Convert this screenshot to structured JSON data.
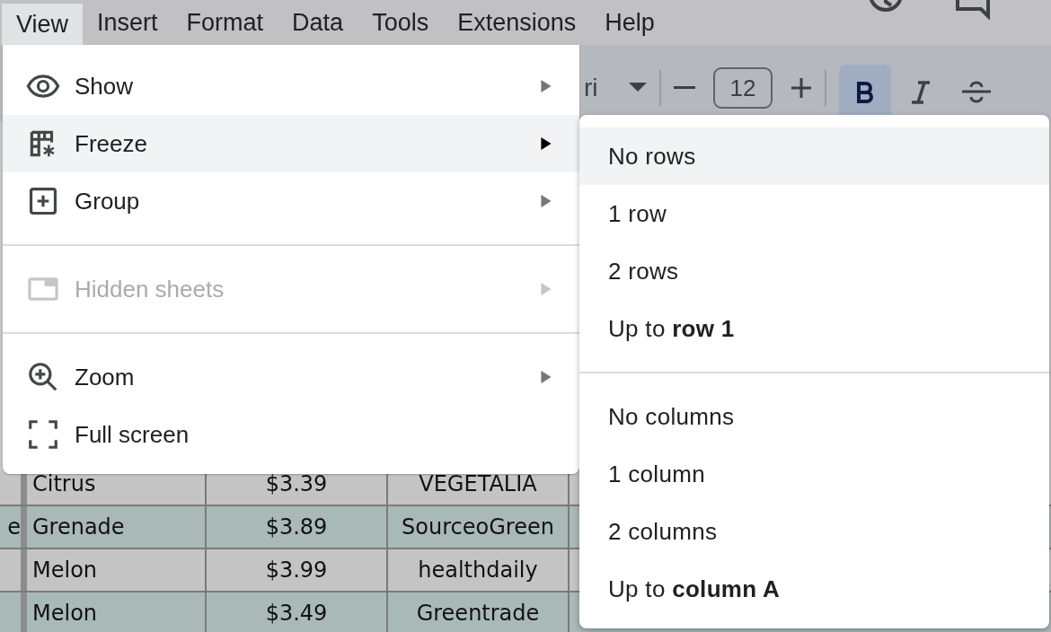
{
  "menubar": {
    "items": [
      {
        "label": "View",
        "selected": true
      },
      {
        "label": "Insert",
        "selected": false
      },
      {
        "label": "Format",
        "selected": false
      },
      {
        "label": "Data",
        "selected": false
      },
      {
        "label": "Tools",
        "selected": false
      },
      {
        "label": "Extensions",
        "selected": false
      },
      {
        "label": "Help",
        "selected": false
      }
    ]
  },
  "toolbar": {
    "font_name": "ri",
    "font_size": "12",
    "bold": {
      "selected": true
    },
    "italic": {
      "selected": false
    },
    "strikethrough": {
      "selected": false
    }
  },
  "sheet": {
    "rows": [
      {
        "cells": [
          "",
          "Citrus",
          "$3.39",
          "VEGETALIA"
        ]
      },
      {
        "cells": [
          "e",
          "Grenade",
          "$3.89",
          "SourceoGreen"
        ]
      },
      {
        "cells": [
          "",
          "Melon",
          "$3.99",
          "healthdaily"
        ]
      },
      {
        "cells": [
          "",
          "Melon",
          "$3.49",
          "Greentrade"
        ]
      }
    ]
  },
  "view_menu": {
    "items": [
      {
        "kind": "submenu",
        "label": "Show",
        "highlighted": false,
        "disabled": false
      },
      {
        "kind": "submenu",
        "label": "Freeze",
        "highlighted": true,
        "disabled": false
      },
      {
        "kind": "submenu",
        "label": "Group",
        "highlighted": false,
        "disabled": false
      },
      {
        "kind": "divider"
      },
      {
        "kind": "submenu",
        "label": "Hidden sheets",
        "highlighted": false,
        "disabled": true
      },
      {
        "kind": "divider"
      },
      {
        "kind": "submenu",
        "label": "Zoom",
        "highlighted": false,
        "disabled": false
      },
      {
        "kind": "action",
        "label": "Full screen",
        "highlighted": false,
        "disabled": false
      }
    ]
  },
  "freeze_submenu": {
    "items": [
      {
        "kind": "item",
        "label": "No rows",
        "highlighted": true
      },
      {
        "kind": "item",
        "label": "1 row",
        "highlighted": false
      },
      {
        "kind": "item",
        "label": "2 rows",
        "highlighted": false
      },
      {
        "kind": "item",
        "label": "Up to **row 1**",
        "highlighted": false
      },
      {
        "kind": "divider"
      },
      {
        "kind": "item",
        "label": "No columns",
        "highlighted": false
      },
      {
        "kind": "item",
        "label": "1 column",
        "highlighted": false
      },
      {
        "kind": "item",
        "label": "2 columns",
        "highlighted": false
      },
      {
        "kind": "item",
        "label": "Up to **column A**",
        "highlighted": false
      }
    ]
  }
}
